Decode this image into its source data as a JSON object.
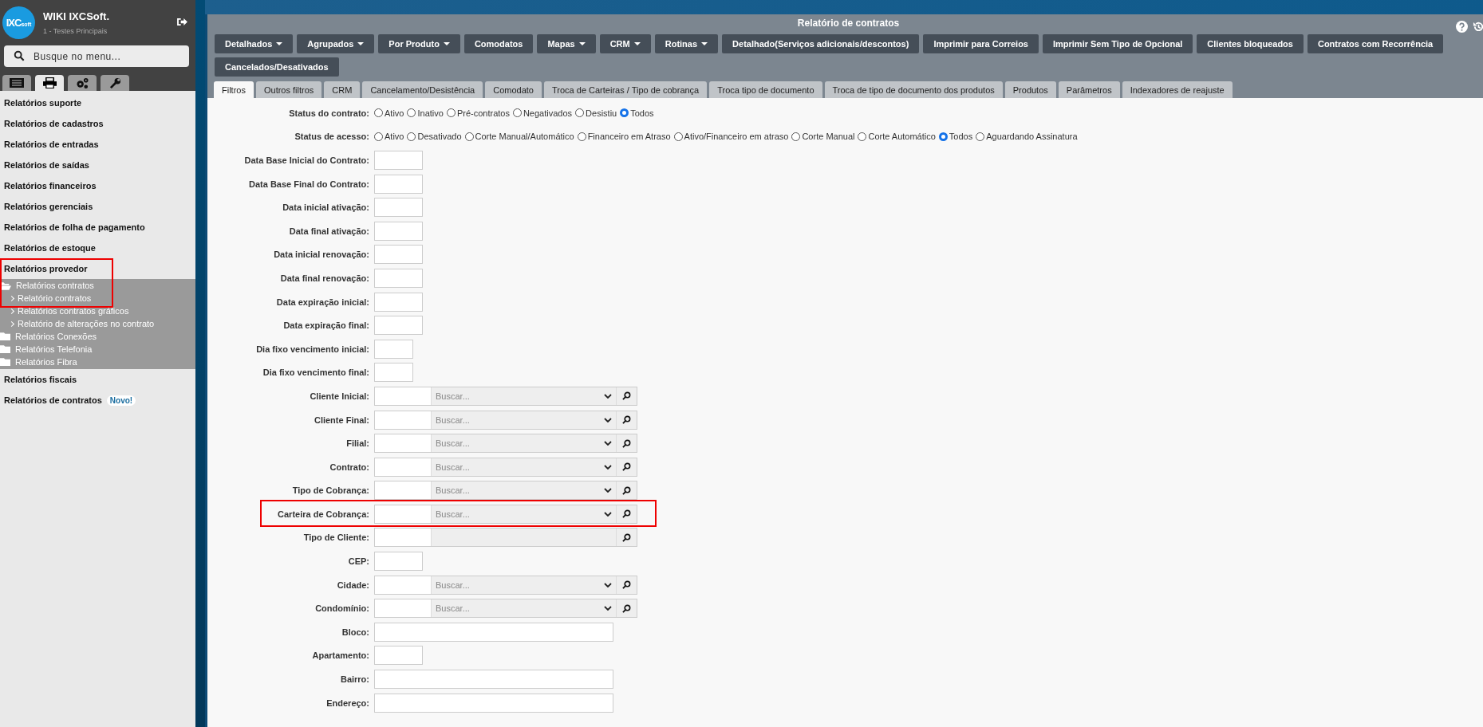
{
  "sidebar": {
    "brand": {
      "logo": "IXC",
      "logo_small": "soft",
      "title": "WIKI IXCSoft.",
      "subtitle": "1 - Testes Principais"
    },
    "search": {
      "placeholder": "Busque no menu..."
    },
    "tabs": [
      {
        "selected": false
      },
      {
        "selected": true
      },
      {
        "selected": false
      },
      {
        "selected": false
      }
    ],
    "items": [
      {
        "label": "Relatórios suporte",
        "highlighted": false
      },
      {
        "label": "Relatórios de cadastros",
        "highlighted": false
      },
      {
        "label": "Relatórios de entradas",
        "highlighted": false
      },
      {
        "label": "Relatórios de saídas",
        "highlighted": false
      },
      {
        "label": "Relatórios financeiros",
        "highlighted": false
      },
      {
        "label": "Relatórios gerenciais",
        "highlighted": false
      },
      {
        "label": "Relatórios de folha de pagamento",
        "highlighted": false
      },
      {
        "label": "Relatórios de estoque",
        "highlighted": false
      },
      {
        "label": "Relatórios provedor",
        "expanded": true,
        "highlighted": true,
        "children": [
          {
            "label": "Relatórios contratos",
            "expanded": true,
            "children": [
              {
                "label": "Relatório contratos"
              },
              {
                "label": "Relatórios contratos gráficos"
              },
              {
                "label": "Relatório de alterações no contrato"
              }
            ]
          },
          {
            "label": "Relatórios Conexões",
            "expanded": false
          },
          {
            "label": "Relatórios Telefonia",
            "expanded": false
          },
          {
            "label": "Relatórios Fibra",
            "expanded": false
          }
        ]
      },
      {
        "label": "Relatórios fiscais",
        "highlighted": false
      },
      {
        "label": "Relatórios de contratos",
        "badge": "Novo!",
        "highlighted": false
      }
    ]
  },
  "window": {
    "title": "Relatório de contratos",
    "buttons": [
      {
        "label": "Detalhados",
        "dropdown": true
      },
      {
        "label": "Agrupados",
        "dropdown": true
      },
      {
        "label": "Por Produto",
        "dropdown": true
      },
      {
        "label": "Comodatos",
        "dropdown": false
      },
      {
        "label": "Mapas",
        "dropdown": true
      },
      {
        "label": "CRM",
        "dropdown": true
      },
      {
        "label": "Rotinas",
        "dropdown": true
      },
      {
        "label": "Detalhado(Serviços adicionais/descontos)",
        "dropdown": false
      },
      {
        "label": "Imprimir para Correios",
        "dropdown": false
      },
      {
        "label": "Imprimir Sem Tipo de Opcional",
        "dropdown": false
      },
      {
        "label": "Clientes bloqueados",
        "dropdown": false
      },
      {
        "label": "Contratos com Recorrência",
        "dropdown": false
      },
      {
        "label": "Cancelados/Desativados",
        "dropdown": false
      }
    ],
    "tabs": [
      {
        "label": "Filtros",
        "selected": true
      },
      {
        "label": "Outros filtros",
        "selected": false
      },
      {
        "label": "CRM",
        "selected": false
      },
      {
        "label": "Cancelamento/Desistência",
        "selected": false
      },
      {
        "label": "Comodato",
        "selected": false
      },
      {
        "label": "Troca de Carteiras / Tipo de cobrança",
        "selected": false
      },
      {
        "label": "Troca tipo de documento",
        "selected": false
      },
      {
        "label": "Troca de tipo de documento dos produtos",
        "selected": false
      },
      {
        "label": "Produtos",
        "selected": false
      },
      {
        "label": "Parâmetros",
        "selected": false
      },
      {
        "label": "Indexadores de reajuste",
        "selected": false
      }
    ],
    "form": [
      {
        "kind": "radio",
        "label": "Status do contrato:",
        "options": [
          {
            "label": "Ativo",
            "selected": false
          },
          {
            "label": "Inativo",
            "selected": false
          },
          {
            "label": "Pré-contratos",
            "selected": false
          },
          {
            "label": "Negativados",
            "selected": false
          },
          {
            "label": "Desistiu",
            "selected": false
          },
          {
            "label": "Todos",
            "selected": true
          }
        ]
      },
      {
        "kind": "radio",
        "label": "Status de acesso:",
        "options": [
          {
            "label": "Ativo",
            "selected": false
          },
          {
            "label": "Desativado",
            "selected": false
          },
          {
            "label": "Corte Manual/Automático",
            "selected": false
          },
          {
            "label": "Financeiro em Atraso",
            "selected": false
          },
          {
            "label": "Ativo/Financeiro em atraso",
            "selected": false
          },
          {
            "label": "Corte Manual",
            "selected": false
          },
          {
            "label": "Corte Automático",
            "selected": false
          },
          {
            "label": "Todos",
            "selected": true
          },
          {
            "label": "Aguardando Assinatura",
            "selected": false
          }
        ]
      },
      {
        "kind": "date",
        "label": "Data Base Inicial do Contrato:"
      },
      {
        "kind": "date",
        "label": "Data Base Final do Contrato:"
      },
      {
        "kind": "date",
        "label": "Data inicial ativação:"
      },
      {
        "kind": "date",
        "label": "Data final ativação:"
      },
      {
        "kind": "date",
        "label": "Data inicial renovação:"
      },
      {
        "kind": "date",
        "label": "Data final renovação:"
      },
      {
        "kind": "date",
        "label": "Data expiração inicial:"
      },
      {
        "kind": "date",
        "label": "Data expiração final:"
      },
      {
        "kind": "small",
        "label": "Dia fixo vencimento inicial:"
      },
      {
        "kind": "small",
        "label": "Dia fixo vencimento final:"
      },
      {
        "kind": "lookup",
        "label": "Cliente Inicial:",
        "placeholder": "Buscar..."
      },
      {
        "kind": "lookup",
        "label": "Cliente Final:",
        "placeholder": "Buscar..."
      },
      {
        "kind": "lookup",
        "label": "Filial:",
        "placeholder": "Buscar..."
      },
      {
        "kind": "lookup",
        "label": "Contrato:",
        "placeholder": "Buscar..."
      },
      {
        "kind": "lookup",
        "label": "Tipo de Cobrança:",
        "placeholder": "Buscar..."
      },
      {
        "kind": "lookup",
        "label": "Carteira de Cobrança:",
        "placeholder": "Buscar...",
        "highlighted": true
      },
      {
        "kind": "lookup-plain",
        "label": "Tipo de Cliente:"
      },
      {
        "kind": "date",
        "label": "CEP:"
      },
      {
        "kind": "lookup",
        "label": "Cidade:",
        "placeholder": "Buscar..."
      },
      {
        "kind": "lookup",
        "label": "Condomínio:",
        "placeholder": "Buscar..."
      },
      {
        "kind": "text",
        "label": "Bloco:"
      },
      {
        "kind": "date",
        "label": "Apartamento:"
      },
      {
        "kind": "text",
        "label": "Bairro:"
      },
      {
        "kind": "text",
        "label": "Endereço:"
      }
    ]
  }
}
